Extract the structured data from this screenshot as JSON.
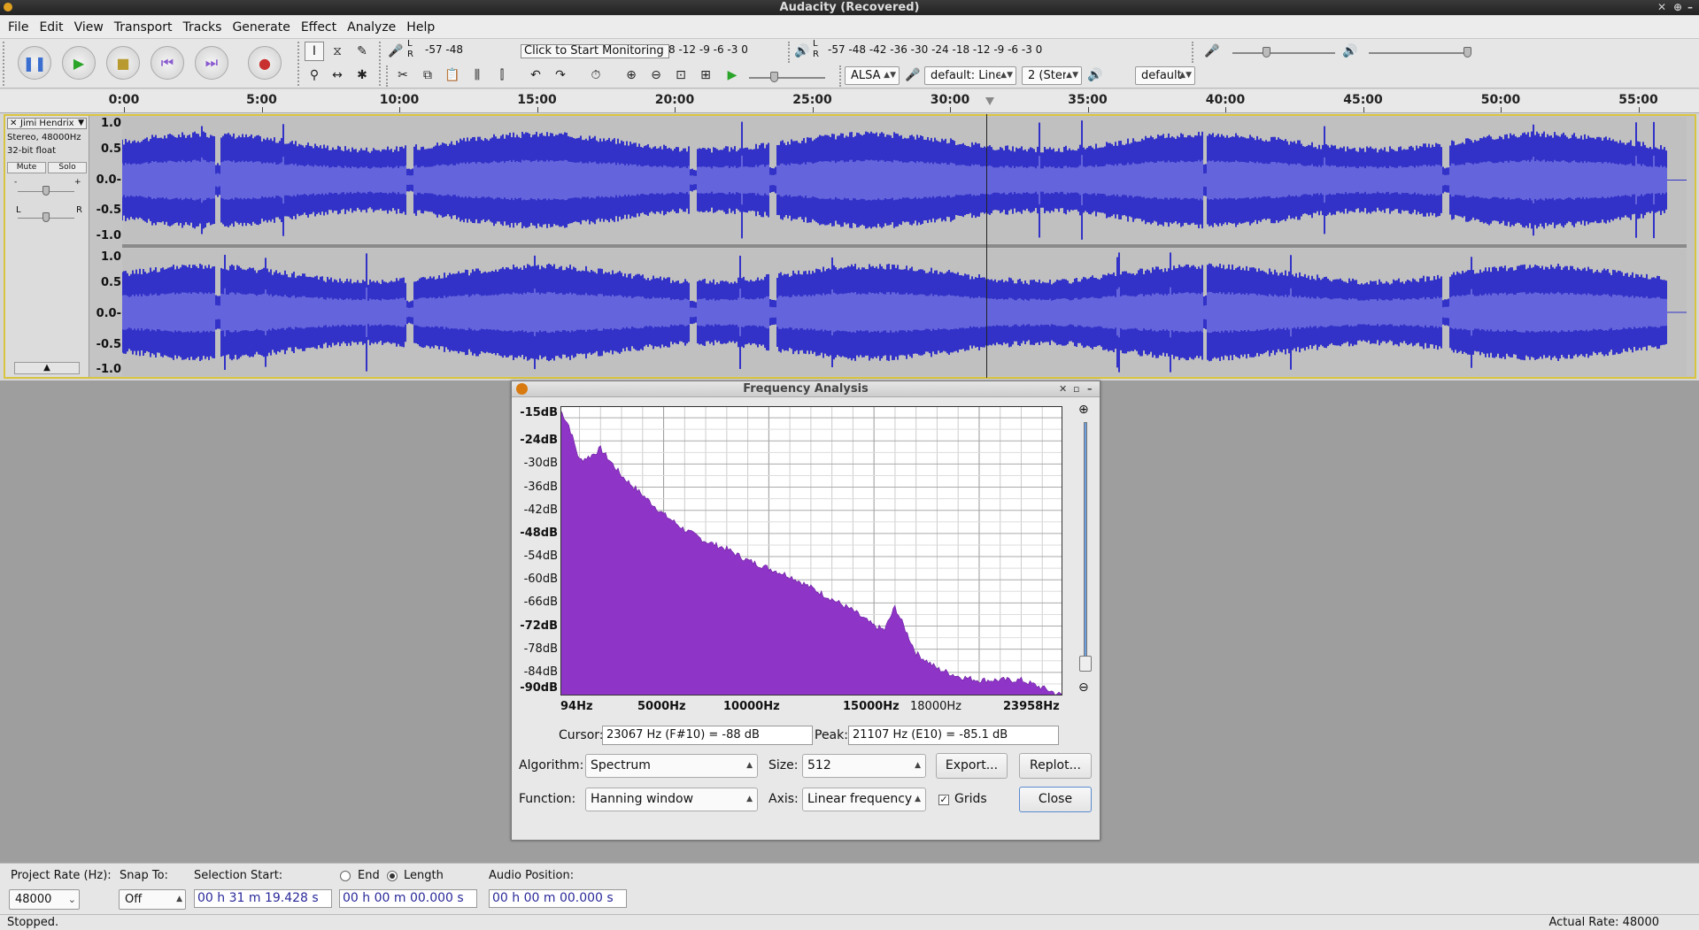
{
  "window": {
    "title": "Audacity (Recovered)"
  },
  "menu": [
    "File",
    "Edit",
    "View",
    "Transport",
    "Tracks",
    "Generate",
    "Effect",
    "Analyze",
    "Help"
  ],
  "meters": {
    "record_scale": "-57    -48",
    "monitor_label": "Click to Start Monitoring",
    "record_scale_right": "8   -12 -9  -6  -3  0",
    "play_scale": "-57       -48       -42       -36       -30       -24       -18       -12 -9   -6  -3  0",
    "L": "L",
    "R": "R"
  },
  "device": {
    "host": "ALSA",
    "input": "default: Line",
    "channels": "2 (Ster",
    "output": "default"
  },
  "timeline": {
    "labels": [
      "0:00",
      "5:00",
      "10:00",
      "15:00",
      "20:00",
      "25:00",
      "30:00",
      "35:00",
      "40:00",
      "45:00",
      "50:00",
      "55:00"
    ]
  },
  "track": {
    "name": "Jimi Hendrix",
    "format": "Stereo, 48000Hz",
    "bits": "32-bit float",
    "mute": "Mute",
    "solo": "Solo",
    "gain_minus": "-",
    "gain_plus": "+",
    "pan_l": "L",
    "pan_r": "R",
    "scale": [
      "1.0",
      "0.5",
      "0.0-",
      "-0.5",
      "-1.0"
    ]
  },
  "dialog": {
    "title": "Frequency Analysis",
    "y_labels": [
      "-15dB",
      "-24dB",
      "-30dB",
      "-36dB",
      "-42dB",
      "-48dB",
      "-54dB",
      "-60dB",
      "-66dB",
      "-72dB",
      "-78dB",
      "-84dB",
      "-90dB"
    ],
    "x_labels": [
      "94Hz",
      "5000Hz",
      "10000Hz",
      "15000Hz",
      "18000Hz",
      "23958Hz"
    ],
    "cursor_label": "Cursor:",
    "cursor_value": "23067 Hz (F#10) = -88 dB",
    "peak_label": "Peak:",
    "peak_value": "21107 Hz (E10) = -85.1 dB",
    "algorithm_label": "Algorithm:",
    "algorithm": "Spectrum",
    "size_label": "Size:",
    "size": "512",
    "export": "Export...",
    "replot": "Replot...",
    "function_label": "Function:",
    "function": "Hanning window",
    "axis_label": "Axis:",
    "axis": "Linear frequency",
    "grids_label": "Grids",
    "close": "Close"
  },
  "selection": {
    "project_rate_label": "Project Rate (Hz):",
    "project_rate": "48000",
    "snap_label": "Snap To:",
    "snap": "Off",
    "start_label": "Selection Start:",
    "end_label": "End",
    "length_label": "Length",
    "start_value": "00 h 31 m 19.428 s",
    "length_value": "00 h 00 m 00.000 s",
    "audio_pos_label": "Audio Position:",
    "audio_pos_value": "00 h 00 m 00.000 s"
  },
  "status": {
    "left": "Stopped.",
    "right": "Actual Rate: 48000"
  },
  "chart_data": {
    "type": "area",
    "xlabel": "",
    "ylabel": "",
    "xlim": [
      94,
      23958
    ],
    "ylim": [
      -90,
      -15
    ],
    "x": [
      94,
      500,
      1000,
      1500,
      2000,
      3000,
      4000,
      5000,
      6000,
      7000,
      8000,
      9000,
      10000,
      11000,
      12000,
      13000,
      14000,
      15000,
      15500,
      16000,
      17000,
      18000,
      19000,
      20000,
      21000,
      22000,
      23000,
      23958
    ],
    "y": [
      -16,
      -20,
      -29,
      -28,
      -26,
      -33,
      -38,
      -43,
      -47,
      -50,
      -52,
      -55,
      -57,
      -59,
      -62,
      -65,
      -68,
      -72,
      -73,
      -67,
      -79,
      -83,
      -85,
      -86,
      -86,
      -86,
      -88,
      -90
    ],
    "grid": true
  }
}
